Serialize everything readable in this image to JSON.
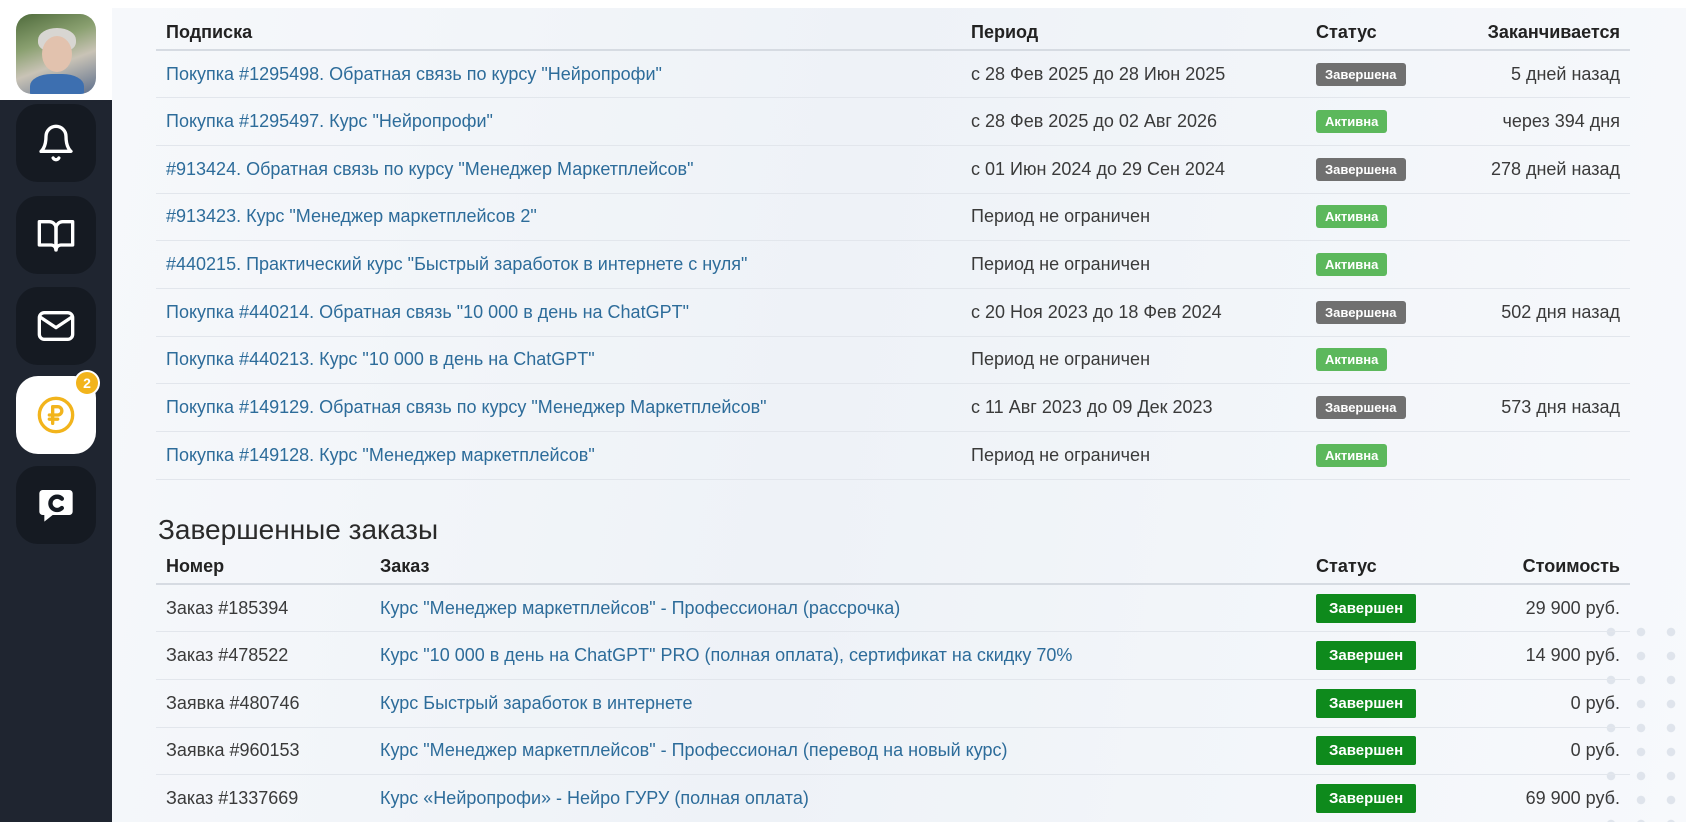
{
  "subscriptions": {
    "headers": {
      "subscription": "Подписка",
      "period": "Период",
      "status": "Статус",
      "ends": "Заканчивается"
    },
    "rows": [
      {
        "title": "Покупка #1295498. Обратная связь по курсу \"Нейропрофи\"",
        "period": "с 28 Фев 2025 до 28 Июн 2025",
        "status": "Завершена",
        "status_type": "done",
        "ends": "5 дней назад"
      },
      {
        "title": "Покупка #1295497. Курс \"Нейропрофи\"",
        "period": "с 28 Фев 2025 до 02 Авг 2026",
        "status": "Активна",
        "status_type": "active",
        "ends": "через 394 дня"
      },
      {
        "title": "#913424. Обратная связь по курсу \"Менеджер Маркетплейсов\"",
        "period": "с 01 Июн 2024 до 29 Сен 2024",
        "status": "Завершена",
        "status_type": "done",
        "ends": "278 дней назад"
      },
      {
        "title": "#913423. Курс \"Менеджер маркетплейсов 2\"",
        "period": "Период не ограничен",
        "status": "Активна",
        "status_type": "active",
        "ends": ""
      },
      {
        "title": "#440215. Практический курс \"Быстрый заработок в интернете с нуля\"",
        "period": "Период не ограничен",
        "status": "Активна",
        "status_type": "active",
        "ends": ""
      },
      {
        "title": "Покупка #440214. Обратная связь \"10 000 в день на ChatGPT\"",
        "period": "с 20 Ноя 2023 до 18 Фев 2024",
        "status": "Завершена",
        "status_type": "done",
        "ends": "502 дня назад"
      },
      {
        "title": "Покупка #440213. Курс \"10 000 в день на ChatGPT\"",
        "period": "Период не ограничен",
        "status": "Активна",
        "status_type": "active",
        "ends": ""
      },
      {
        "title": "Покупка #149129. Обратная связь по курсу \"Менеджер Маркетплейсов\"",
        "period": "с 11 Авг 2023 до 09 Дек 2023",
        "status": "Завершена",
        "status_type": "done",
        "ends": "573 дня назад"
      },
      {
        "title": "Покупка #149128. Курс \"Менеджер маркетплейсов\"",
        "period": "Период не ограничен",
        "status": "Активна",
        "status_type": "active",
        "ends": ""
      }
    ]
  },
  "orders": {
    "title": "Завершенные заказы",
    "headers": {
      "number": "Номер",
      "order": "Заказ",
      "status": "Статус",
      "cost": "Стоимость"
    },
    "rows": [
      {
        "number": "Заказ #185394",
        "order": "Курс \"Менеджер маркетплейсов\" - Профессионал (рассрочка)",
        "status": "Завершен",
        "cost": "29 900 руб."
      },
      {
        "number": "Заказ #478522",
        "order": "Курс \"10 000 в день на ChatGPT\" PRO (полная оплата), сертификат на скидку 70%",
        "status": "Завершен",
        "cost": "14 900 руб."
      },
      {
        "number": "Заявка #480746",
        "order": "Курс Быстрый заработок в интернете",
        "status": "Завершен",
        "cost": "0 руб."
      },
      {
        "number": "Заявка #960153",
        "order": "Курс \"Менеджер маркетплейсов\" - Профессионал (перевод на новый курс)",
        "status": "Завершен",
        "cost": "0 руб."
      },
      {
        "number": "Заказ #1337669",
        "order": "Курс «Нейропрофи» - Нейро ГУРУ (полная оплата)",
        "status": "Завершен",
        "cost": "69 900 руб."
      }
    ]
  },
  "sidebar": {
    "payments_badge": "2",
    "icons": [
      "bell-icon",
      "book-icon",
      "mail-icon",
      "ruble-icon",
      "chat-logo-icon"
    ]
  },
  "colors": {
    "sidebar_bg": "#1f2530",
    "link": "#2d6c9a",
    "status_done": "#707070",
    "status_active": "#5cb85c",
    "status_completed_order": "#0e8a1c",
    "badge": "#f2b41c"
  }
}
